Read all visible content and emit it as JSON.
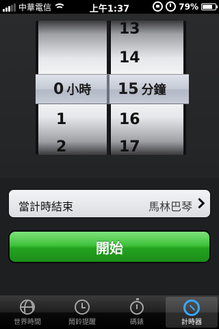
{
  "status_bar": {
    "carrier": "中華電信",
    "time": "上午1:37",
    "battery_percent": "79%",
    "battery_level": 0.79,
    "icons": [
      "signal-icon",
      "wifi-icon",
      "rotation-lock-icon",
      "alarm-clock-icon",
      "battery-icon"
    ]
  },
  "picker": {
    "hours": {
      "above": [],
      "selected": "0",
      "unit": "小時",
      "below": [
        "1",
        "2"
      ]
    },
    "minutes": {
      "above": [
        "13",
        "14"
      ],
      "selected": "15",
      "unit": "分鐘",
      "below": [
        "16",
        "17"
      ]
    }
  },
  "when_timer_ends": {
    "label": "當計時結束",
    "value": "馬林巴琴"
  },
  "start_button": {
    "label": "開始",
    "color": "#2fb52b"
  },
  "tabs": [
    {
      "label": "世界時間",
      "icon": "globe-icon",
      "active": false
    },
    {
      "label": "鬧鈴提醒",
      "icon": "alarm-clock-icon",
      "active": false
    },
    {
      "label": "碼錶",
      "icon": "stopwatch-icon",
      "active": false
    },
    {
      "label": "計時器",
      "icon": "timer-icon",
      "active": true
    }
  ]
}
